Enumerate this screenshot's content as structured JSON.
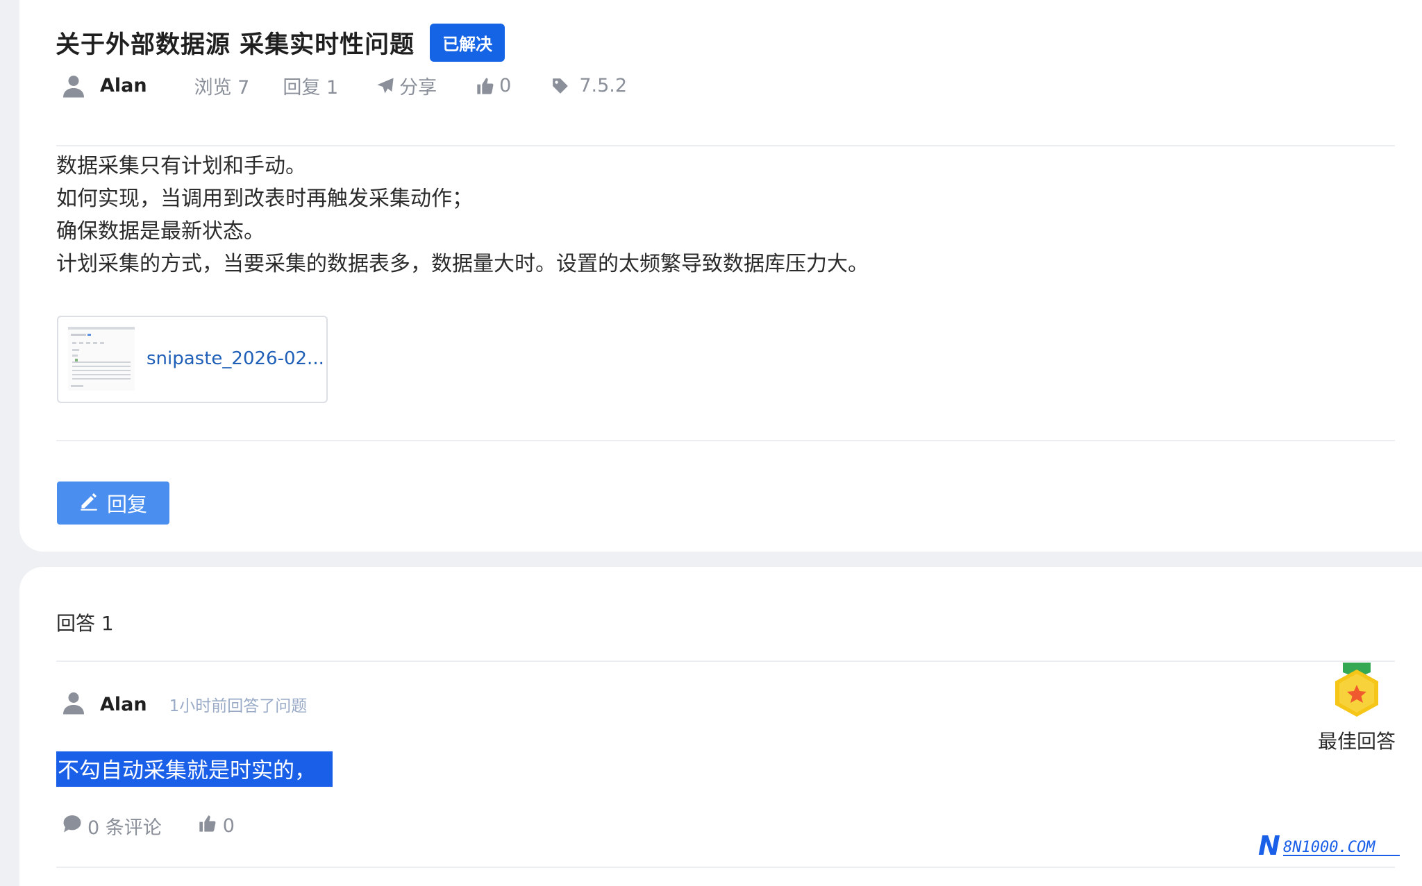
{
  "question": {
    "title": "关于外部数据源 采集实时性问题",
    "status_badge": "已解决",
    "author": "Alan",
    "views": "浏览 7",
    "replies": "回复 1",
    "share": "分享",
    "likes": "0",
    "version": "7.5.2",
    "content": [
      "数据采集只有计划和手动。",
      "如何实现，当调用到改表时再触发采集动作；",
      "确保数据是最新状态。",
      "计划采集的方式，当要采集的数据表多，数据量大时。设置的太频繁导致数据库压力大。"
    ],
    "attachment_name": "snipaste_2026-02...",
    "reply_button": "回复"
  },
  "answers": {
    "count_label": "回答 1",
    "items": [
      {
        "author": "Alan",
        "time": "1小时前回答了问题",
        "text": "不勾自动采集就是时实的，",
        "comments": "0 条评论",
        "likes": "0",
        "best_label": "最佳回答"
      }
    ]
  },
  "watermark": "8N1000.COM",
  "colors": {
    "accent": "#1664e6",
    "button": "#4a8ff0",
    "muted": "#8a8f99",
    "link": "#1f5fb8",
    "selection": "#1a5fe8"
  },
  "icons": [
    "user-icon",
    "send-icon",
    "thumbs-up-icon",
    "tag-icon",
    "edit-icon",
    "comment-icon",
    "best-answer-medal-icon"
  ]
}
